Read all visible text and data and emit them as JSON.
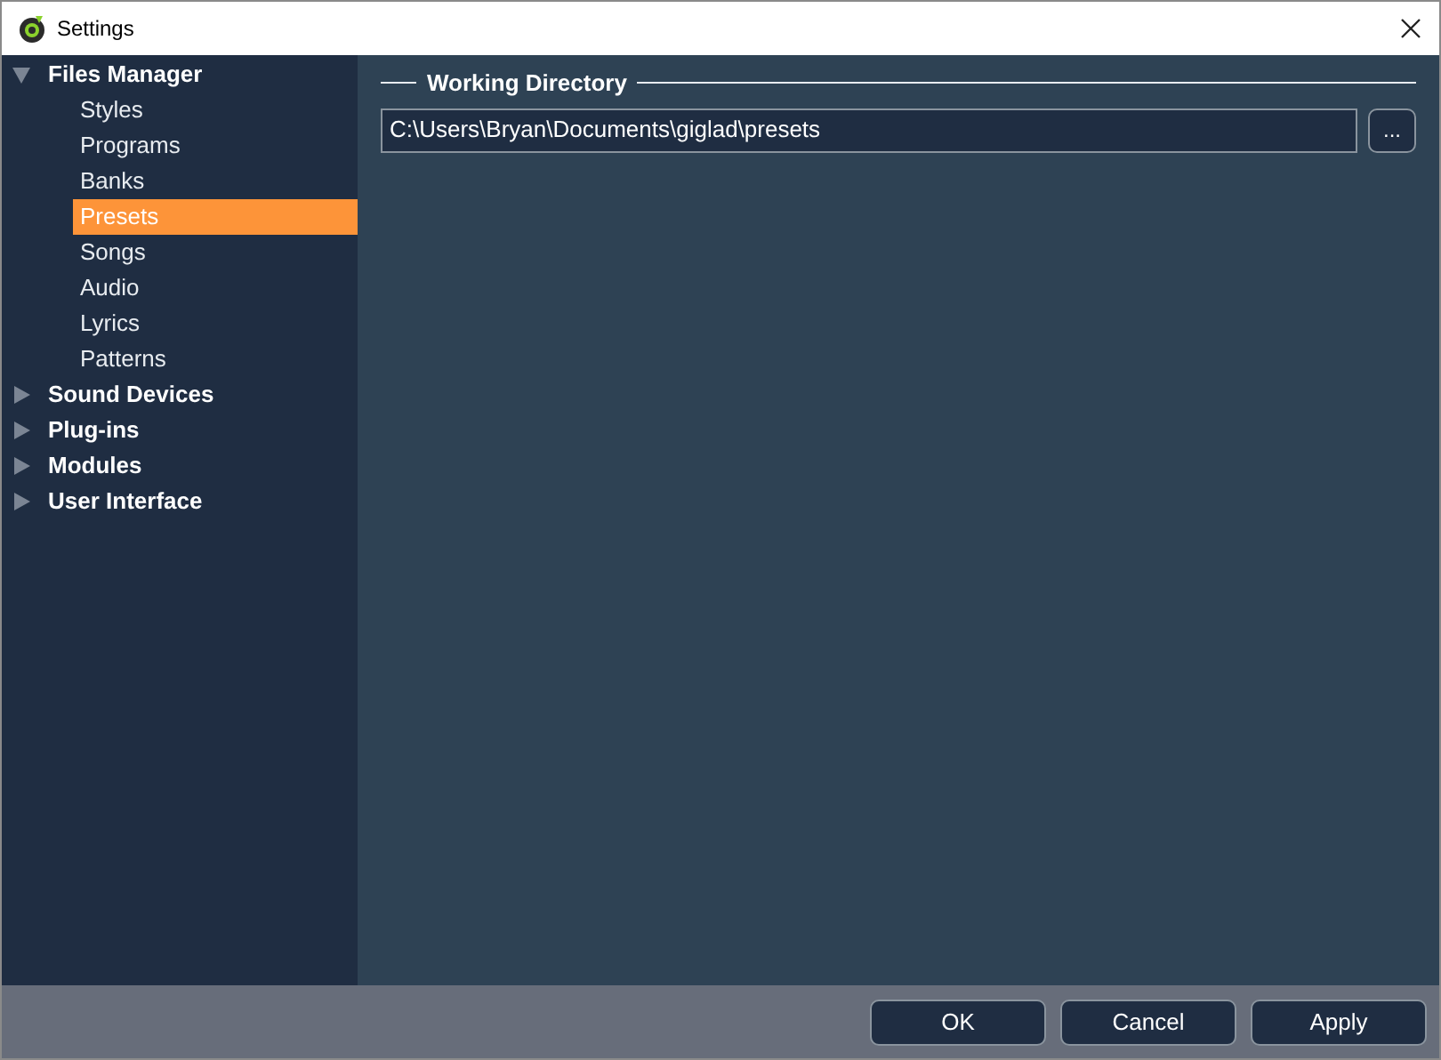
{
  "window": {
    "title": "Settings"
  },
  "sidebar": {
    "items": [
      {
        "label": "Files Manager",
        "expanded": true,
        "selected": false,
        "children": [
          {
            "label": "Styles",
            "selected": false
          },
          {
            "label": "Programs",
            "selected": false
          },
          {
            "label": "Banks",
            "selected": false
          },
          {
            "label": "Presets",
            "selected": true
          },
          {
            "label": "Songs",
            "selected": false
          },
          {
            "label": "Audio",
            "selected": false
          },
          {
            "label": "Lyrics",
            "selected": false
          },
          {
            "label": "Patterns",
            "selected": false
          }
        ]
      },
      {
        "label": "Sound Devices",
        "expanded": false,
        "selected": false
      },
      {
        "label": "Plug-ins",
        "expanded": false,
        "selected": false
      },
      {
        "label": "Modules",
        "expanded": false,
        "selected": false
      },
      {
        "label": "User Interface",
        "expanded": false,
        "selected": false
      }
    ]
  },
  "working_directory": {
    "title": "Working Directory",
    "value": "C:\\Users\\Bryan\\Documents\\giglad\\presets",
    "browse_button": "..."
  },
  "buttons": [
    "OK",
    "Cancel",
    "Apply"
  ]
}
